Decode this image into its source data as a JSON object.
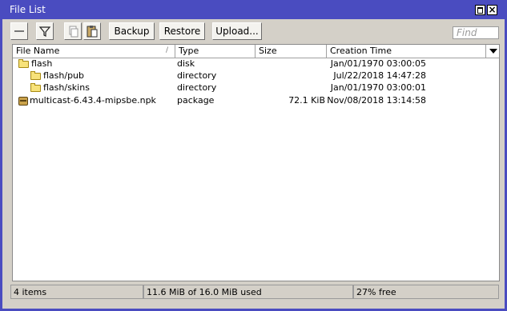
{
  "window": {
    "title": "File List"
  },
  "toolbar": {
    "backup_label": "Backup",
    "restore_label": "Restore",
    "upload_label": "Upload...",
    "find_placeholder": "Find"
  },
  "table": {
    "columns": [
      "File Name",
      "Type",
      "Size",
      "Creation Time"
    ],
    "sort_indicator": "/",
    "rows": [
      {
        "name": "flash",
        "type": "disk",
        "size": "",
        "creation_time": "Jan/01/1970 03:00:05",
        "icon": "folder-icon",
        "indent": 0
      },
      {
        "name": "flash/pub",
        "type": "directory",
        "size": "",
        "creation_time": "Jul/22/2018 14:47:28",
        "icon": "folder-icon",
        "indent": 1
      },
      {
        "name": "flash/skins",
        "type": "directory",
        "size": "",
        "creation_time": "Jan/01/1970 03:00:01",
        "icon": "folder-icon",
        "indent": 1
      },
      {
        "name": "multicast-6.43.4-mipsbe.npk",
        "type": "package",
        "size": "72.1 KiB",
        "creation_time": "Nov/08/2018 13:14:58",
        "icon": "package-icon",
        "indent": 0
      }
    ]
  },
  "status": {
    "items": "4 items",
    "used": "11.6 MiB of 16.0 MiB used",
    "free": "27% free"
  },
  "colors": {
    "titlebar": "#4a4cc0",
    "folder": "#f7e27a"
  }
}
